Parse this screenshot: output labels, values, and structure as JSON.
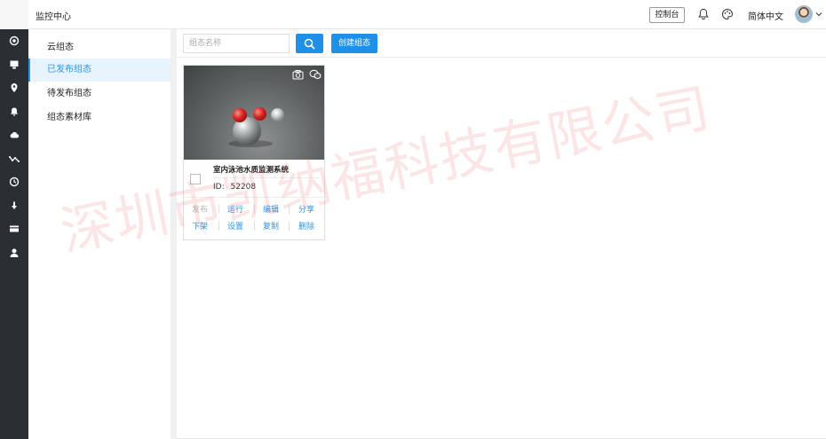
{
  "header": {
    "app_title": "监控中心",
    "console_label": "控制台",
    "language": "简体中文",
    "icons": [
      "bell-icon",
      "palette-icon",
      "avatar",
      "chevron-down-icon"
    ]
  },
  "iconbar": {
    "icons": [
      "target-icon",
      "monitor-icon",
      "location-icon",
      "bell-icon",
      "cloud-icon",
      "chart-line-icon",
      "clock-icon",
      "download-icon",
      "card-icon",
      "user-icon"
    ]
  },
  "subnav": {
    "heading": "云组态",
    "items": [
      {
        "label": "已发布组态",
        "active": true
      },
      {
        "label": "待发布组态",
        "active": false
      },
      {
        "label": "组态素材库",
        "active": false
      }
    ]
  },
  "toolbar": {
    "search_placeholder": "组态名称",
    "create_label": "创建组态"
  },
  "cards": [
    {
      "title": "室内泳池水质监测系统",
      "id_label": "ID:",
      "id_value": "52208",
      "actions_row1": [
        {
          "label": "发布",
          "enabled": false
        },
        {
          "label": "运行",
          "enabled": true
        },
        {
          "label": "编辑",
          "enabled": true
        },
        {
          "label": "分享",
          "enabled": true
        }
      ],
      "actions_row2": [
        {
          "label": "下架",
          "enabled": true
        },
        {
          "label": "设置",
          "enabled": true
        },
        {
          "label": "复制",
          "enabled": true
        },
        {
          "label": "删除",
          "enabled": true
        }
      ]
    }
  ],
  "watermark": "深圳市凯纳福科技有限公司",
  "colors": {
    "accent": "#1e90e8",
    "sidebar_bg": "#2a2f33",
    "active_bg": "#e8f4fd",
    "disabled": "#b5b5b5",
    "watermark": "#eb5050"
  }
}
